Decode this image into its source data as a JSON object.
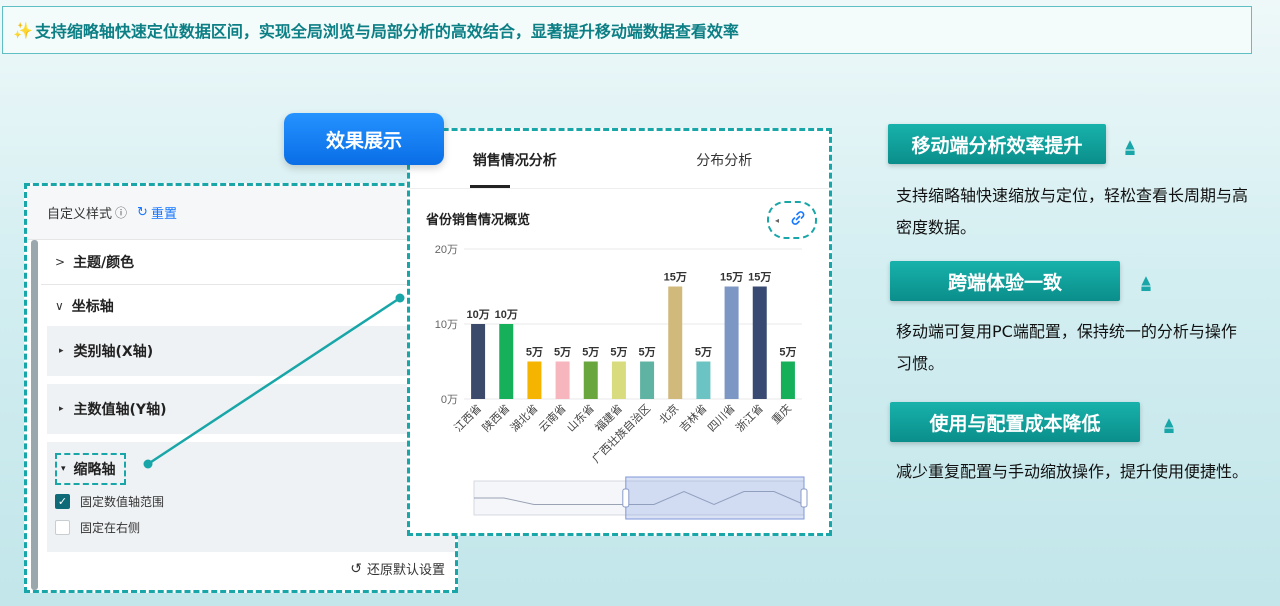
{
  "banner": {
    "icon": "sparkles-icon",
    "icon_glyph": "✨",
    "text": "支持缩略轴快速定位数据区间，实现全局浏览与局部分析的高效结合，显著提升移动端数据查看效率"
  },
  "badge": {
    "label": "效果展示"
  },
  "settings": {
    "title": "自定义样式",
    "info_glyph": "ⓘ",
    "reset_glyph": "↻",
    "reset_label": "重置",
    "sections": {
      "theme": "主题/颜色",
      "axis": "坐标轴"
    },
    "subsections": {
      "x_axis": "类别轴(X轴)",
      "y_axis": "主数值轴(Y轴)",
      "zoom_axis": "缩略轴"
    },
    "checkboxes": {
      "fixed_range": {
        "label": "固定数值轴范围",
        "checked": true
      },
      "fixed_right": {
        "label": "固定在右侧",
        "checked": false
      }
    },
    "restore_glyph": "↺",
    "restore_label": "还原默认设置"
  },
  "chart_panel": {
    "tabs": [
      "销售情况分析",
      "分布分析"
    ],
    "active_tab": 0,
    "title": "省份销售情况概览",
    "link_glyph": "🔗"
  },
  "chart_data": {
    "type": "bar",
    "title": "省份销售情况概览",
    "categories": [
      "江西省",
      "陕西省",
      "湖北省",
      "云南省",
      "山东省",
      "福建省",
      "广西壮族自治区",
      "北京",
      "吉林省",
      "四川省",
      "浙江省",
      "重庆"
    ],
    "values": [
      10,
      10,
      5,
      5,
      5,
      5,
      5,
      15,
      5,
      15,
      15,
      5
    ],
    "value_labels": [
      "10万",
      "10万",
      "5万",
      "5万",
      "5万",
      "5万",
      "5万",
      "15万",
      "5万",
      "15万",
      "15万",
      "5万"
    ],
    "colors": [
      "#3b4a6b",
      "#16b05a",
      "#f5b400",
      "#f7b6bd",
      "#6aa63e",
      "#d9dc7e",
      "#5fb3a3",
      "#d1b97c",
      "#6cc3c3",
      "#7c97c4",
      "#384a72",
      "#16b05a"
    ],
    "y_ticks": [
      "0万",
      "10万",
      "20万"
    ],
    "ylim": [
      0,
      20
    ],
    "grid": true
  },
  "features": [
    {
      "title": "移动端分析效率提升",
      "desc": "支持缩略轴快速缩放与定位，轻松查看长周期与高密度数据。"
    },
    {
      "title": "跨端体验一致",
      "desc": "移动端可复用PC端配置，保持统一的分析与操作习惯。"
    },
    {
      "title": "使用与配置成本降低",
      "desc": "减少重复配置与手动缩放操作，提升使用便捷性。"
    }
  ],
  "up_glyph": "▲"
}
